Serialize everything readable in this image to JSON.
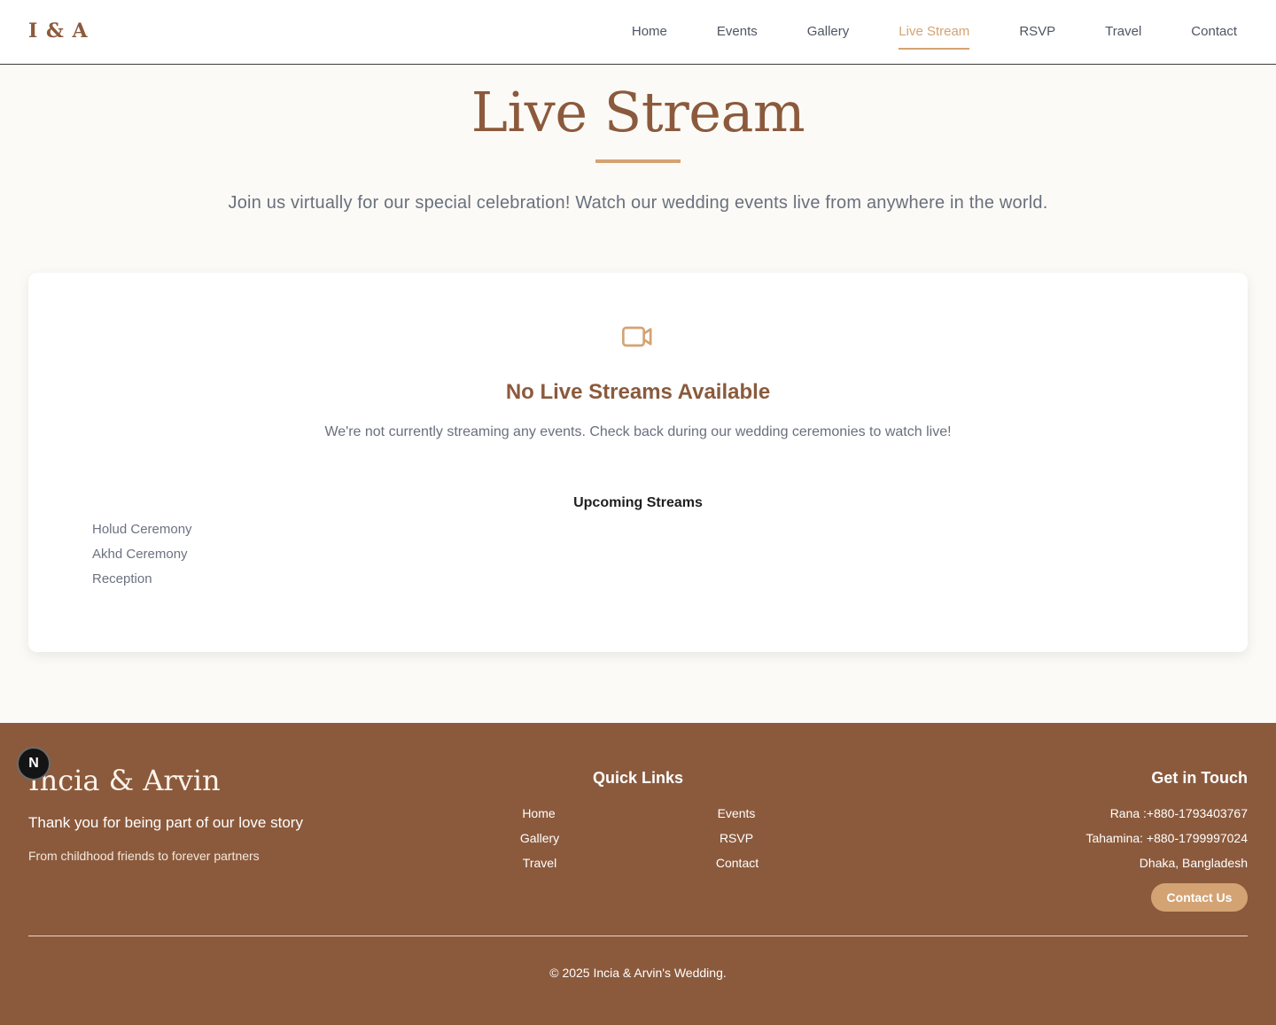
{
  "header": {
    "brand": "I & A",
    "nav": [
      {
        "label": "Home"
      },
      {
        "label": "Events"
      },
      {
        "label": "Gallery"
      },
      {
        "label": "Live Stream",
        "active": true
      },
      {
        "label": "RSVP"
      },
      {
        "label": "Travel"
      },
      {
        "label": "Contact"
      }
    ]
  },
  "hero": {
    "title": "Live Stream",
    "subtitle": "Join us virtually for our special celebration! Watch our wedding events live from anywhere in the world."
  },
  "card": {
    "icon": "video-camera-icon",
    "title": "No Live Streams Available",
    "subtitle": "We're not currently streaming any events. Check back during our wedding ceremonies to watch live!",
    "upcoming_title": "Upcoming Streams",
    "upcoming": [
      "Holud Ceremony",
      "Akhd Ceremony",
      "Reception"
    ]
  },
  "footer": {
    "logo": "Incia & Arvin",
    "tagline": "Thank you for being part of our love story",
    "tagline2": "From childhood friends to forever partners",
    "quick_links_title": "Quick Links",
    "quick_links": [
      "Home",
      "Events",
      "Gallery",
      "RSVP",
      "Travel",
      "Contact"
    ],
    "get_in_touch_title": "Get in Touch",
    "contact_lines": [
      "Rana :+880-1793403767",
      "Tahamina: +880-1799997024",
      "Dhaka, Bangladesh"
    ],
    "contact_button": "Contact Us",
    "copyright": "© 2025 Incia & Arvin's Wedding."
  },
  "badge": {
    "label": "N"
  },
  "colors": {
    "brand": "#8b5a3c",
    "accent": "#d4a373",
    "background": "#fcfaf6"
  }
}
